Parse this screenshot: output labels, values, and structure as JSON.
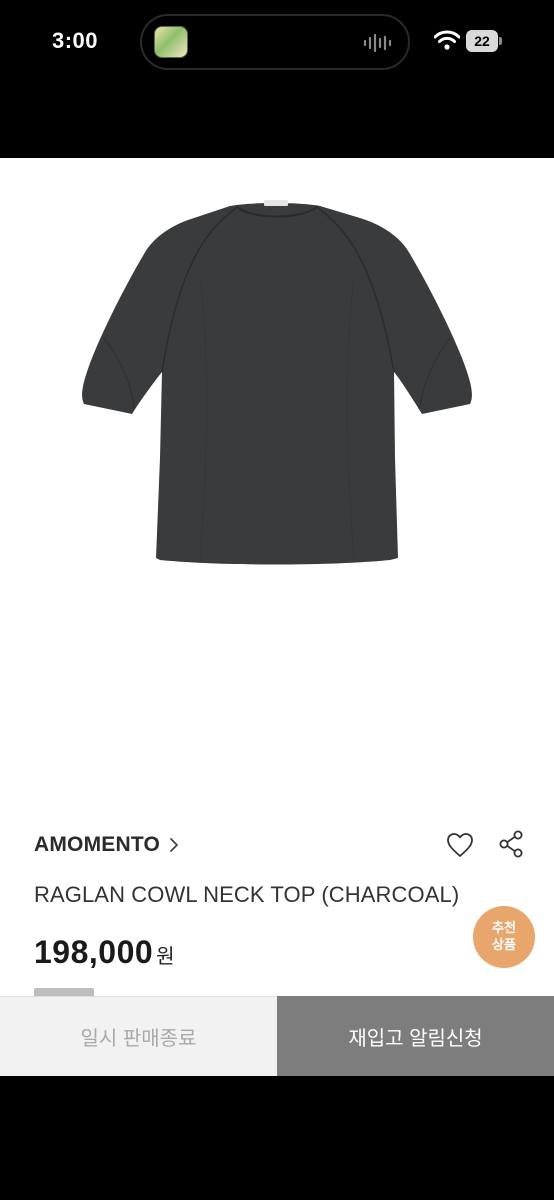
{
  "status_bar": {
    "time": "3:00",
    "battery": "22",
    "icons": [
      "app-thumbnail-icon",
      "audio-wave-icon",
      "wifi-icon",
      "battery-icon"
    ]
  },
  "product": {
    "brand": "AMOMENTO",
    "name": "RAGLAN COWL NECK TOP (CHARCOAL)",
    "price": "198,000",
    "currency": "원",
    "image": "charcoal-raglan-top-image",
    "garment_color": "#3a3b3d"
  },
  "actions": {
    "like_icon": "heart-icon",
    "share_icon": "share-icon"
  },
  "recommend_badge": {
    "line1": "추천",
    "line2": "상품",
    "color": "#e9a66c"
  },
  "bottom_bar": {
    "left_label": "일시 판매종료",
    "right_label": "재입고 알림신청",
    "right_bg": "#7d7d7d"
  }
}
